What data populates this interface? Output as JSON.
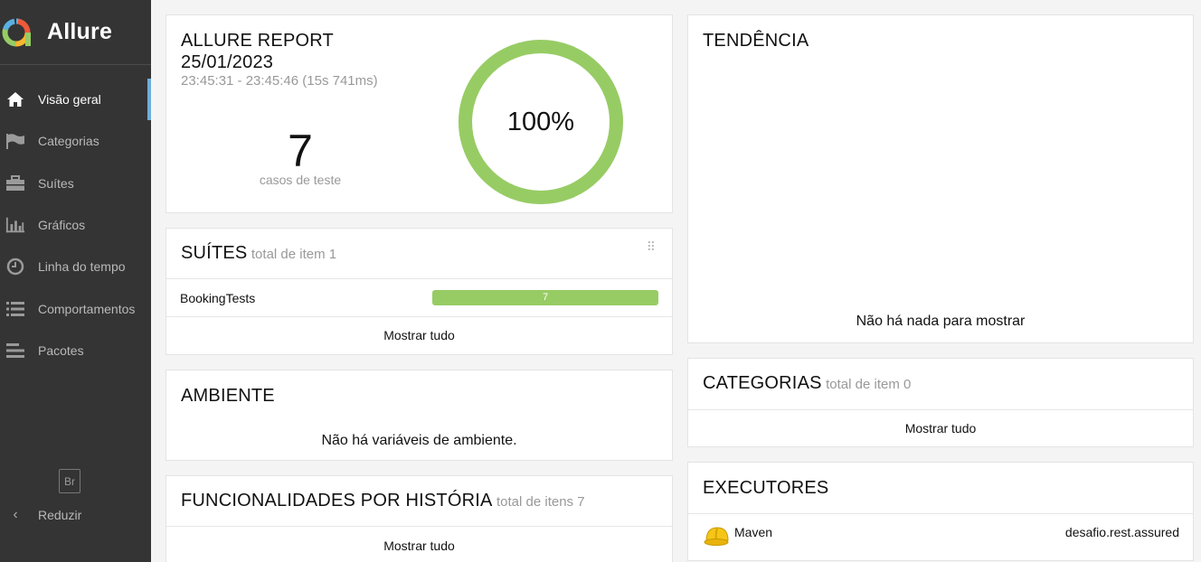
{
  "app": {
    "name": "Allure"
  },
  "sidebar": {
    "items": [
      {
        "label": "Visão geral",
        "icon": "home-icon",
        "active": true
      },
      {
        "label": "Categorias",
        "icon": "flag-icon",
        "active": false
      },
      {
        "label": "Suítes",
        "icon": "briefcase-icon",
        "active": false
      },
      {
        "label": "Gráficos",
        "icon": "bar-chart-icon",
        "active": false
      },
      {
        "label": "Linha do tempo",
        "icon": "clock-icon",
        "active": false
      },
      {
        "label": "Comportamentos",
        "icon": "list-icon",
        "active": false
      },
      {
        "label": "Pacotes",
        "icon": "align-left-icon",
        "active": false
      }
    ],
    "language": "Br",
    "collapse_label": "Reduzir"
  },
  "summary": {
    "title": "ALLURE REPORT",
    "date": "25/01/2023",
    "time_range": "23:45:31 - 23:45:46 (15s 741ms)",
    "test_count": "7",
    "test_count_label": "casos de teste",
    "pass_rate": "100%",
    "pass_fraction": 1.0,
    "ring_color": "#97cc64"
  },
  "suites": {
    "title": "SUÍTES",
    "subtitle": "total de item 1",
    "rows": [
      {
        "name": "BookingTests",
        "passed": 7,
        "bar_label": "7"
      }
    ],
    "show_all": "Mostrar tudo",
    "bar_color": "#97cc64"
  },
  "environment": {
    "title": "AMBIENTE",
    "empty_text": "Não há variáveis de ambiente."
  },
  "features": {
    "title": "FUNCIONALIDADES POR HISTÓRIA",
    "subtitle": "total de itens 7",
    "show_all": "Mostrar tudo"
  },
  "trend": {
    "title": "TENDÊNCIA",
    "empty_text": "Não há nada para mostrar"
  },
  "categories": {
    "title": "CATEGORIAS",
    "subtitle": "total de item 0",
    "show_all": "Mostrar tudo"
  },
  "executors": {
    "title": "EXECUTORES",
    "rows": [
      {
        "icon": "maven-helmet-icon",
        "name": "Maven",
        "build": "desafio.rest.assured"
      }
    ]
  }
}
